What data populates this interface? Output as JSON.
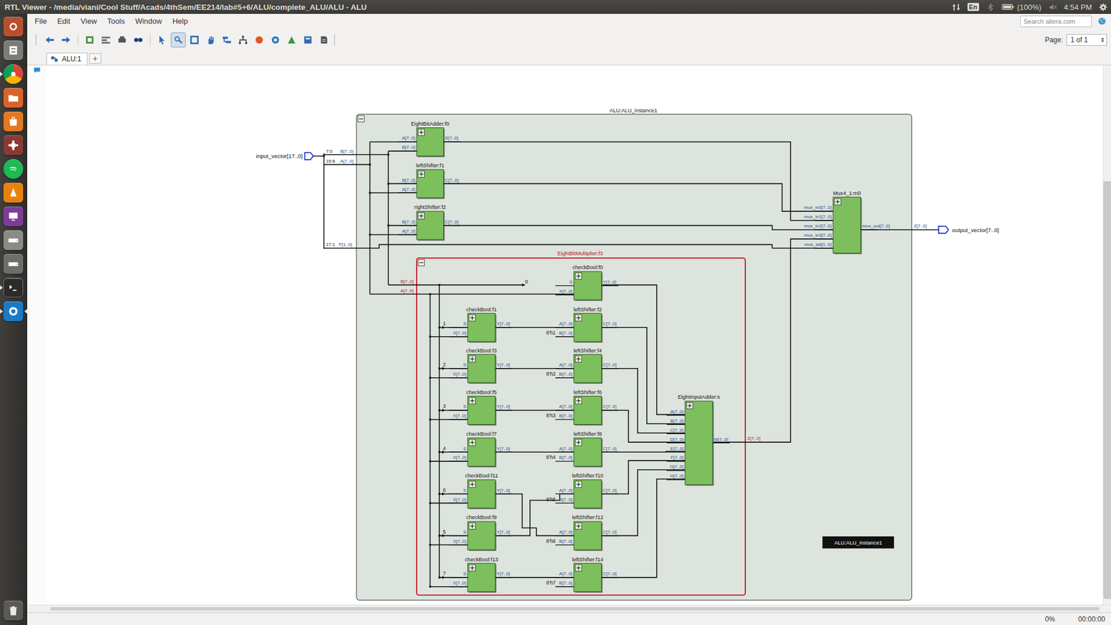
{
  "window": {
    "title": "RTL Viewer - /media/viani/Cool Stuff/Acads/4thSem/EE214/lab#5+6/ALU/complete_ALU/ALU - ALU"
  },
  "top_panel": {
    "keyboard": "En",
    "battery": "(100%)",
    "clock": "4:54 PM"
  },
  "launcher": [
    {
      "running": false,
      "focused": false
    },
    {
      "running": false,
      "focused": false
    },
    {
      "running": true,
      "focused": false
    },
    {
      "running": false,
      "focused": false
    },
    {
      "running": false,
      "focused": false
    },
    {
      "running": false,
      "focused": false
    },
    {
      "running": false,
      "focused": false
    },
    {
      "running": false,
      "focused": false
    },
    {
      "running": false,
      "focused": false
    },
    {
      "running": false,
      "focused": false
    },
    {
      "running": false,
      "focused": false
    },
    {
      "running": true,
      "focused": false
    },
    {
      "running": true,
      "focused": true
    },
    {
      "running": false,
      "focused": false
    }
  ],
  "menu": [
    "File",
    "Edit",
    "View",
    "Tools",
    "Window",
    "Help"
  ],
  "search": {
    "placeholder": "Search altera.com"
  },
  "toolbar": {
    "tools": [
      {
        "selected": false
      },
      {
        "selected": false
      },
      {
        "selected": false
      },
      {
        "selected": false
      },
      {
        "selected": false
      },
      {
        "selected": false
      },
      {
        "selected": false
      },
      {
        "selected": true
      },
      {
        "selected": false
      },
      {
        "selected": false
      },
      {
        "selected": false
      },
      {
        "selected": false
      },
      {
        "selected": false
      },
      {
        "selected": false
      },
      {
        "selected": false
      },
      {
        "selected": false
      },
      {
        "selected": false
      }
    ],
    "page_label": "Page:",
    "page_value": "1 of 1"
  },
  "tabs": [
    {
      "label": "ALU:1",
      "selected": true
    }
  ],
  "new_tab": "+",
  "diagram": {
    "input_port": "input_vector[17..0]",
    "output_port": "output_vector[7..0]",
    "bus_labels": [
      "7:0",
      "15:8",
      "17:1",
      "B[7..0]",
      "A[7..0]",
      "P[1..0]",
      "Z[7..0]"
    ],
    "instance": {
      "title": "ALU:ALU_instance1",
      "expanded": true
    },
    "modules": [
      {
        "title": "EightBitAdder:f0",
        "expanded": false,
        "inputs": [
          {
            "pin": "A[7..0]"
          },
          {
            "pin": "B[7..0]"
          }
        ],
        "outputs": [
          "S[7..0]"
        ]
      },
      {
        "title": "leftShifter:f1",
        "expanded": false,
        "inputs": [
          {
            "pin": "B[7..0]"
          },
          {
            "pin": "A[7..0]"
          }
        ],
        "outputs": [
          "C[7..0]"
        ]
      },
      {
        "title": "rightShifter:f2",
        "expanded": false,
        "inputs": [
          {
            "pin": "B[7..0]"
          },
          {
            "pin": "A[7..0]"
          }
        ],
        "outputs": [
          "C[7..0]"
        ]
      },
      {
        "title": "Mux4_1:m0",
        "expanded": false,
        "inputs": [
          {
            "pin": "mux_in0[7..0]"
          },
          {
            "pin": "mux_in1[7..0]"
          },
          {
            "pin": "mux_in2[7..0]"
          },
          {
            "pin": "mux_in3[7..0]"
          },
          {
            "pin": "mux_sel[1..0]"
          }
        ],
        "outputs": [
          "mux_out[7..0]"
        ]
      }
    ],
    "multiplier": {
      "title": "EightBitMultiplier:f3",
      "expanded": true,
      "inputs": [
        "B[7..0]",
        "A[7..0]"
      ],
      "output": "Z[7..0]",
      "modules": [
        {
          "title": "checkBool:f0",
          "expanded": false,
          "inputs": [
            {
              "pin": "S",
              "const": "0"
            },
            {
              "pin": "X[7..0]"
            }
          ],
          "outputs": [
            "Y[7..0]"
          ]
        },
        {
          "title": "checkBool:f1",
          "expanded": false,
          "inputs": [
            {
              "pin": "S",
              "const": "1"
            },
            {
              "pin": "X[7..0]"
            }
          ],
          "outputs": [
            "Y[7..0]"
          ]
        },
        {
          "title": "leftShifter:f2",
          "expanded": false,
          "inputs": [
            {
              "pin": "A[7..0]"
            },
            {
              "pin": "B[7..0]",
              "const": "8'h1"
            }
          ],
          "outputs": [
            "C[7..0]"
          ]
        },
        {
          "title": "checkBool:f3",
          "expanded": false,
          "inputs": [
            {
              "pin": "S",
              "const": "2"
            },
            {
              "pin": "X[7..0]"
            }
          ],
          "outputs": [
            "Y[7..0]"
          ]
        },
        {
          "title": "leftShifter:f4",
          "expanded": false,
          "inputs": [
            {
              "pin": "A[7..0]"
            },
            {
              "pin": "B[7..0]",
              "const": "8'h2"
            }
          ],
          "outputs": [
            "C[7..0]"
          ]
        },
        {
          "title": "checkBool:f5",
          "expanded": false,
          "inputs": [
            {
              "pin": "S",
              "const": "3"
            },
            {
              "pin": "X[7..0]"
            }
          ],
          "outputs": [
            "Y[7..0]"
          ]
        },
        {
          "title": "leftShifter:f6",
          "expanded": false,
          "inputs": [
            {
              "pin": "A[7..0]"
            },
            {
              "pin": "B[7..0]",
              "const": "8'h3"
            }
          ],
          "outputs": [
            "C[7..0]"
          ]
        },
        {
          "title": "checkBool:f7",
          "expanded": false,
          "inputs": [
            {
              "pin": "S",
              "const": "4"
            },
            {
              "pin": "X[7..0]"
            }
          ],
          "outputs": [
            "Y[7..0]"
          ]
        },
        {
          "title": "leftShifter:f8",
          "expanded": false,
          "inputs": [
            {
              "pin": "A[7..0]"
            },
            {
              "pin": "B[7..0]",
              "const": "8'h4"
            }
          ],
          "outputs": [
            "C[7..0]"
          ]
        },
        {
          "title": "checkBool:f11",
          "expanded": false,
          "inputs": [
            {
              "pin": "S",
              "const": "6"
            },
            {
              "pin": "X[7..0]"
            }
          ],
          "outputs": [
            "Y[7..0]"
          ]
        },
        {
          "title": "leftShifter:f10",
          "expanded": false,
          "inputs": [
            {
              "pin": "A[7..0]"
            },
            {
              "pin": "B[7..0]",
              "const": "8'h5"
            }
          ],
          "outputs": [
            "C[7..0]"
          ]
        },
        {
          "title": "checkBool:f9",
          "expanded": false,
          "inputs": [
            {
              "pin": "S",
              "const": "5"
            },
            {
              "pin": "X[7..0]"
            }
          ],
          "outputs": [
            "Y[7..0]"
          ]
        },
        {
          "title": "leftShifter:f12",
          "expanded": false,
          "inputs": [
            {
              "pin": "A[7..0]"
            },
            {
              "pin": "B[7..0]",
              "const": "8'h6"
            }
          ],
          "outputs": [
            "C[7..0]"
          ]
        },
        {
          "title": "checkBool:f13",
          "expanded": false,
          "inputs": [
            {
              "pin": "S",
              "const": "7"
            },
            {
              "pin": "X[7..0]"
            }
          ],
          "outputs": [
            "Y[7..0]"
          ]
        },
        {
          "title": "leftShifter:f14",
          "expanded": false,
          "inputs": [
            {
              "pin": "A[7..0]"
            },
            {
              "pin": "B[7..0]",
              "const": "8'h7"
            }
          ],
          "outputs": [
            "C[7..0]"
          ]
        },
        {
          "title": "EightInputAdder:s",
          "expanded": false,
          "inputs": [
            {
              "pin": "A[7..0]"
            },
            {
              "pin": "B[7..0]"
            },
            {
              "pin": "C[7..0]"
            },
            {
              "pin": "D[7..0]"
            },
            {
              "pin": "E[7..0]"
            },
            {
              "pin": "F[7..0]"
            },
            {
              "pin": "G[7..0]"
            },
            {
              "pin": "H[7..0]"
            }
          ],
          "outputs": [
            "M[7..0]"
          ]
        }
      ]
    },
    "tooltip": "ALU:ALU_instance1"
  },
  "status_bar": {
    "progress": "0%",
    "elapsed": "00:00:00"
  }
}
